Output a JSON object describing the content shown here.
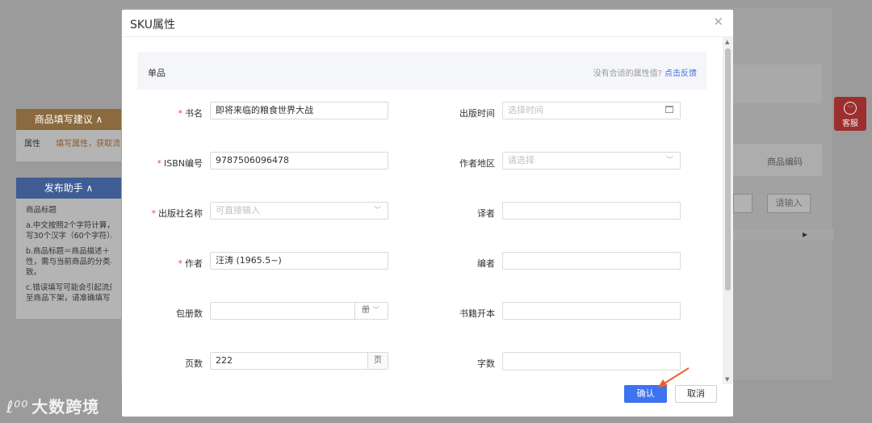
{
  "background": {
    "panel_suggest": {
      "title": "商品填写建议 ∧",
      "row_label": "属性",
      "row_value": "填写属性，获取流"
    },
    "panel_helper": {
      "title": "发布助手 ∧",
      "heading": "商品标题",
      "lines": [
        "a.中文按照2个字符计算，",
        "写30个汉字（60个字符）。",
        "b.商品标题＝商品描述＋",
        "性，需与当前商品的分类、",
        "致。",
        "c.错误填写可能会引起流量",
        "至商品下架，请准确填写！"
      ]
    },
    "customer_service": "客服",
    "table_header": "商品编码",
    "table_input_placeholder": "请输入",
    "logo_text": "大数跨境"
  },
  "modal": {
    "title": "SKU属性",
    "section": {
      "title": "单品",
      "hint": "没有合适的属性值?",
      "hint_link": "点击反馈"
    },
    "fields": {
      "book_name": {
        "label": "书名",
        "required": true,
        "value": "即将来临的粮食世界大战"
      },
      "publish_time": {
        "label": "出版时间",
        "required": false,
        "placeholder": "选择时间"
      },
      "isbn": {
        "label": "ISBN编号",
        "required": true,
        "value": "9787506096478"
      },
      "author_region": {
        "label": "作者地区",
        "required": false,
        "placeholder": "请选择"
      },
      "publisher": {
        "label": "出版社名称",
        "required": true,
        "placeholder": "可直接输入"
      },
      "translator": {
        "label": "译者",
        "required": false,
        "value": ""
      },
      "author": {
        "label": "作者",
        "required": true,
        "value": "汪涛 (1965.5~)"
      },
      "editor": {
        "label": "编者",
        "required": false,
        "value": ""
      },
      "volumes": {
        "label": "包册数",
        "required": false,
        "value": "",
        "unit": "册"
      },
      "format": {
        "label": "书籍开本",
        "required": false,
        "value": ""
      },
      "pages": {
        "label": "页数",
        "required": false,
        "value": "222",
        "unit": "页"
      },
      "word_count": {
        "label": "字数",
        "required": false,
        "value": ""
      }
    },
    "buttons": {
      "confirm": "确认",
      "cancel": "取消"
    },
    "colors": {
      "primary": "#3d73f0",
      "required": "#f04848",
      "link": "#3d6fe0"
    }
  }
}
